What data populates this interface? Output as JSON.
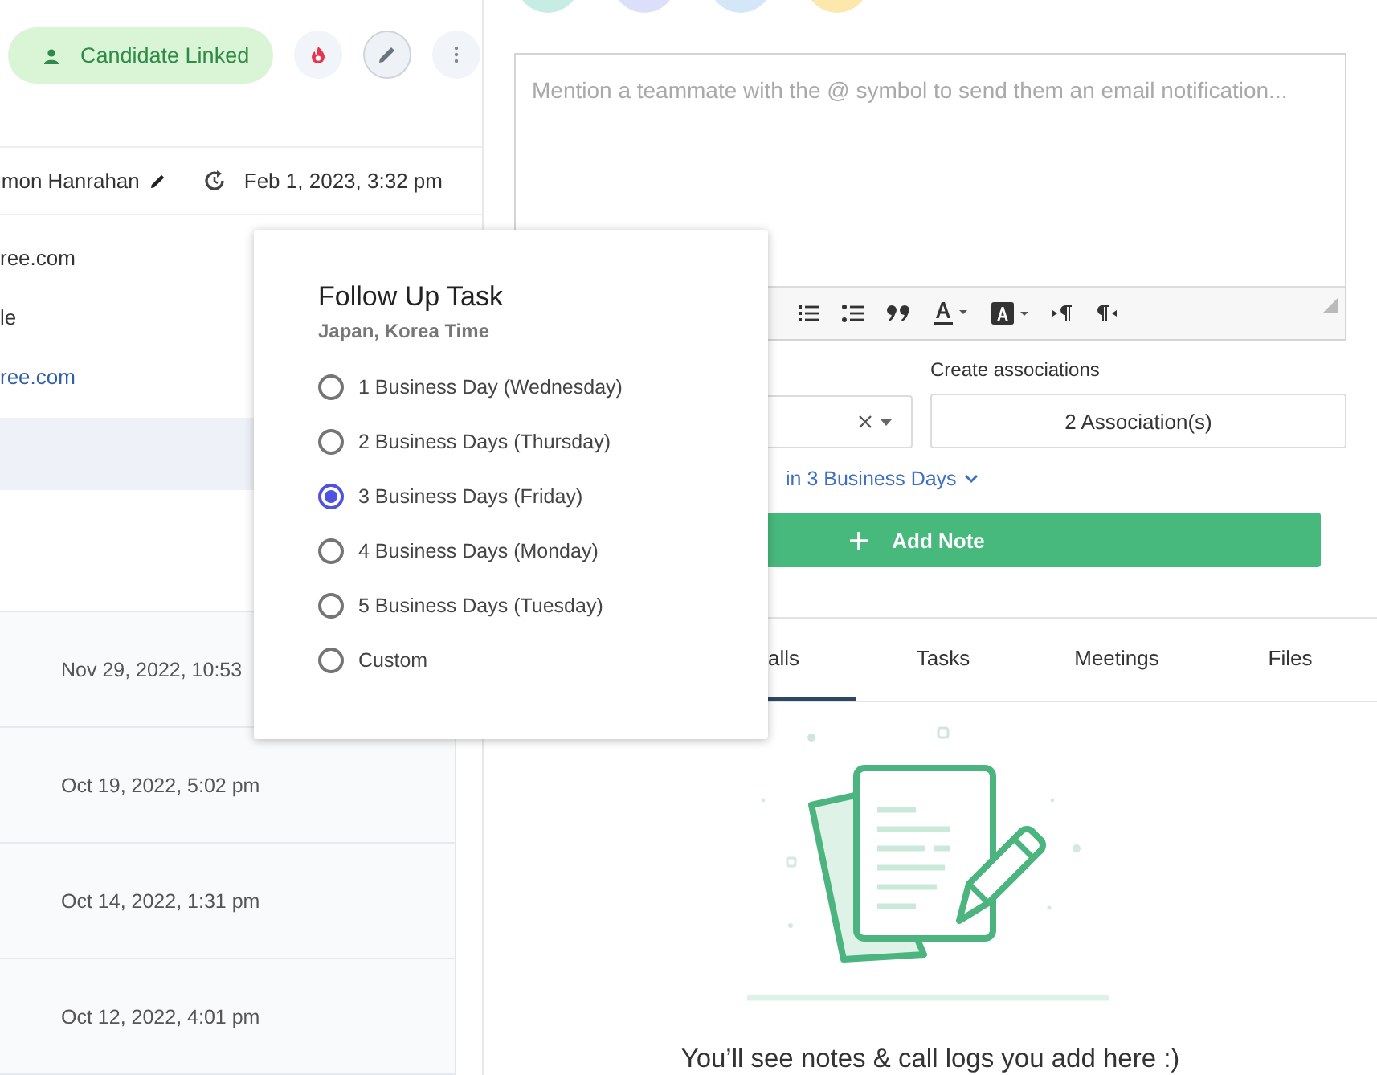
{
  "header": {
    "status_pill": "Candidate Linked"
  },
  "owner": {
    "name": "imon Hanrahan",
    "updated": "Feb 1, 2023, 3:32 pm"
  },
  "details": [
    {
      "text": "ree.com",
      "kind": "text"
    },
    {
      "text": "le",
      "kind": "text"
    },
    {
      "text": "ree.com",
      "kind": "link"
    }
  ],
  "history": [
    {
      "date": "Nov 29, 2022, 10:53"
    },
    {
      "date": "Oct 19, 2022, 5:02 pm"
    },
    {
      "date": "Oct 14, 2022, 1:31 pm"
    },
    {
      "date": "Oct 12, 2022, 4:01 pm"
    }
  ],
  "composer": {
    "placeholder": "Mention a teammate with the @ symbol to send them an email notification...",
    "associations_label": "Create associations",
    "associations_button": "2 Association(s)",
    "follow_up_link": "in 3 Business Days",
    "add_button": "Add Note"
  },
  "tabs": [
    {
      "label": "alls",
      "selected": true
    },
    {
      "label": "Tasks",
      "selected": false
    },
    {
      "label": "Meetings",
      "selected": false
    },
    {
      "label": "Files",
      "selected": false
    }
  ],
  "empty_state": "You’ll see notes & call logs you add here :)",
  "popup": {
    "title": "Follow Up Task",
    "subtitle": "Japan, Korea Time",
    "options": [
      {
        "label": "1 Business Day (Wednesday)",
        "selected": false
      },
      {
        "label": "2 Business Days (Thursday)",
        "selected": false
      },
      {
        "label": "3 Business Days (Friday)",
        "selected": true
      },
      {
        "label": "4 Business Days (Monday)",
        "selected": false
      },
      {
        "label": "5 Business Days (Tuesday)",
        "selected": false
      },
      {
        "label": "Custom",
        "selected": false
      }
    ]
  }
}
